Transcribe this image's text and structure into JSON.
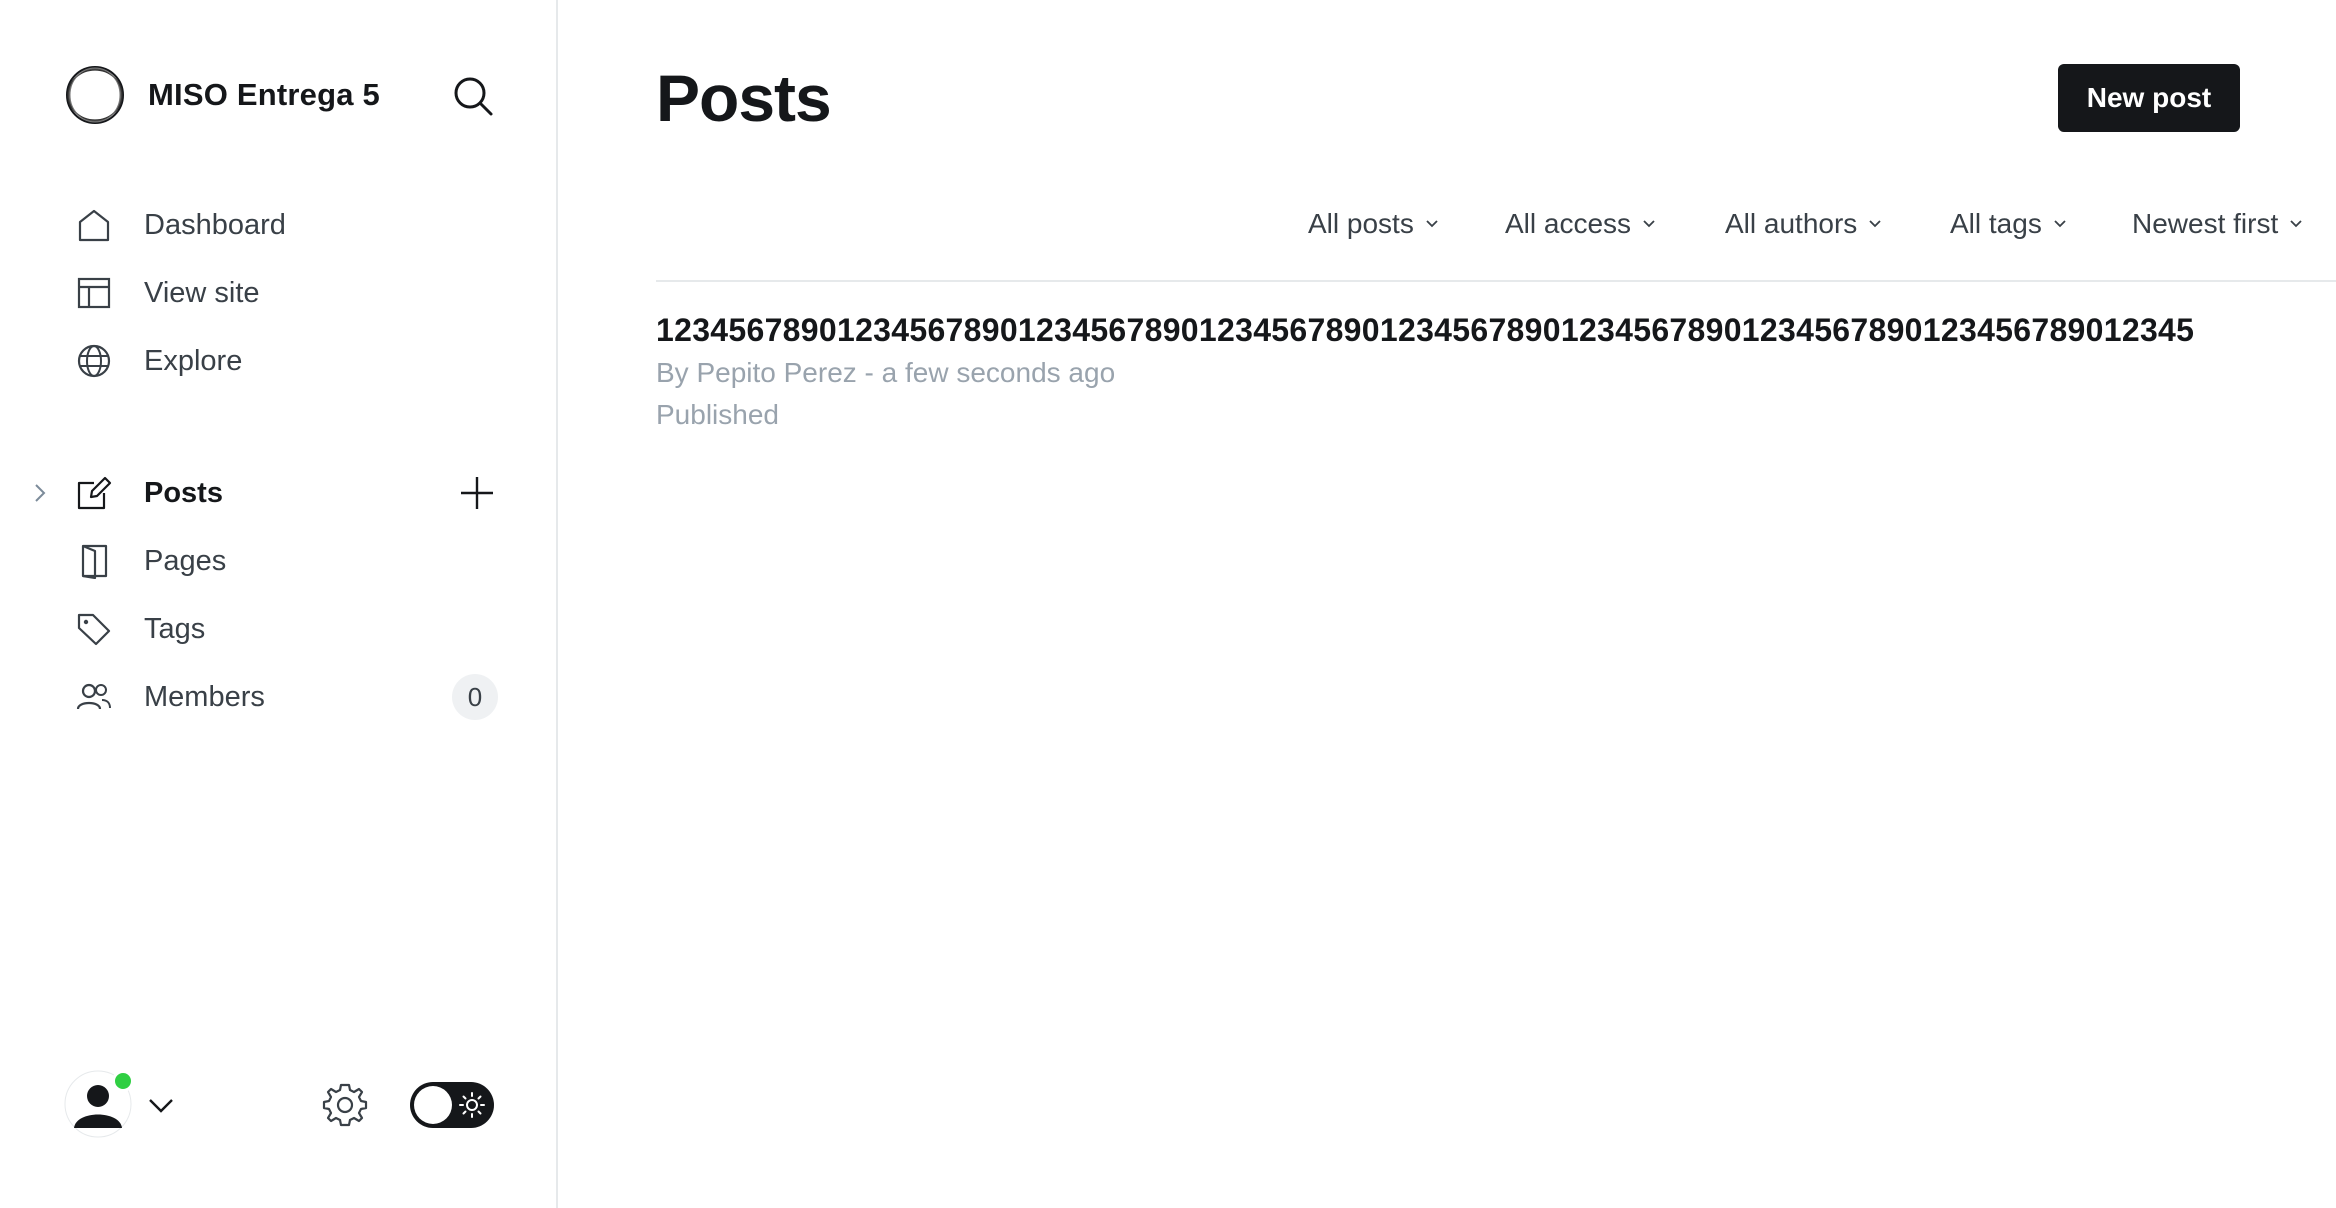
{
  "sidebar": {
    "site_name": "MISO Entrega 5",
    "primary_nav": [
      {
        "label": "Dashboard",
        "icon": "home-icon"
      },
      {
        "label": "View site",
        "icon": "layout-icon"
      },
      {
        "label": "Explore",
        "icon": "globe-icon"
      }
    ],
    "content_nav": [
      {
        "label": "Posts",
        "icon": "edit-icon",
        "active": true
      },
      {
        "label": "Pages",
        "icon": "page-icon"
      },
      {
        "label": "Tags",
        "icon": "tag-icon"
      },
      {
        "label": "Members",
        "icon": "members-icon",
        "count": "0"
      }
    ],
    "footer": {
      "status_color": "#30cf43",
      "theme": "light"
    }
  },
  "header": {
    "title": "Posts",
    "new_post_label": "New post"
  },
  "filters": [
    {
      "label": "All posts"
    },
    {
      "label": "All access"
    },
    {
      "label": "All authors"
    },
    {
      "label": "All tags"
    },
    {
      "label": "Newest first"
    }
  ],
  "posts": [
    {
      "title": "1234567890123456789012345678901234567890123456789012345678901234567890123456789012345",
      "meta": "By Pepito Perez - a few seconds ago",
      "status": "Published"
    }
  ],
  "colors": {
    "primary_button": "#15171a",
    "muted_text": "#99a3ad",
    "online": "#30cf43"
  }
}
